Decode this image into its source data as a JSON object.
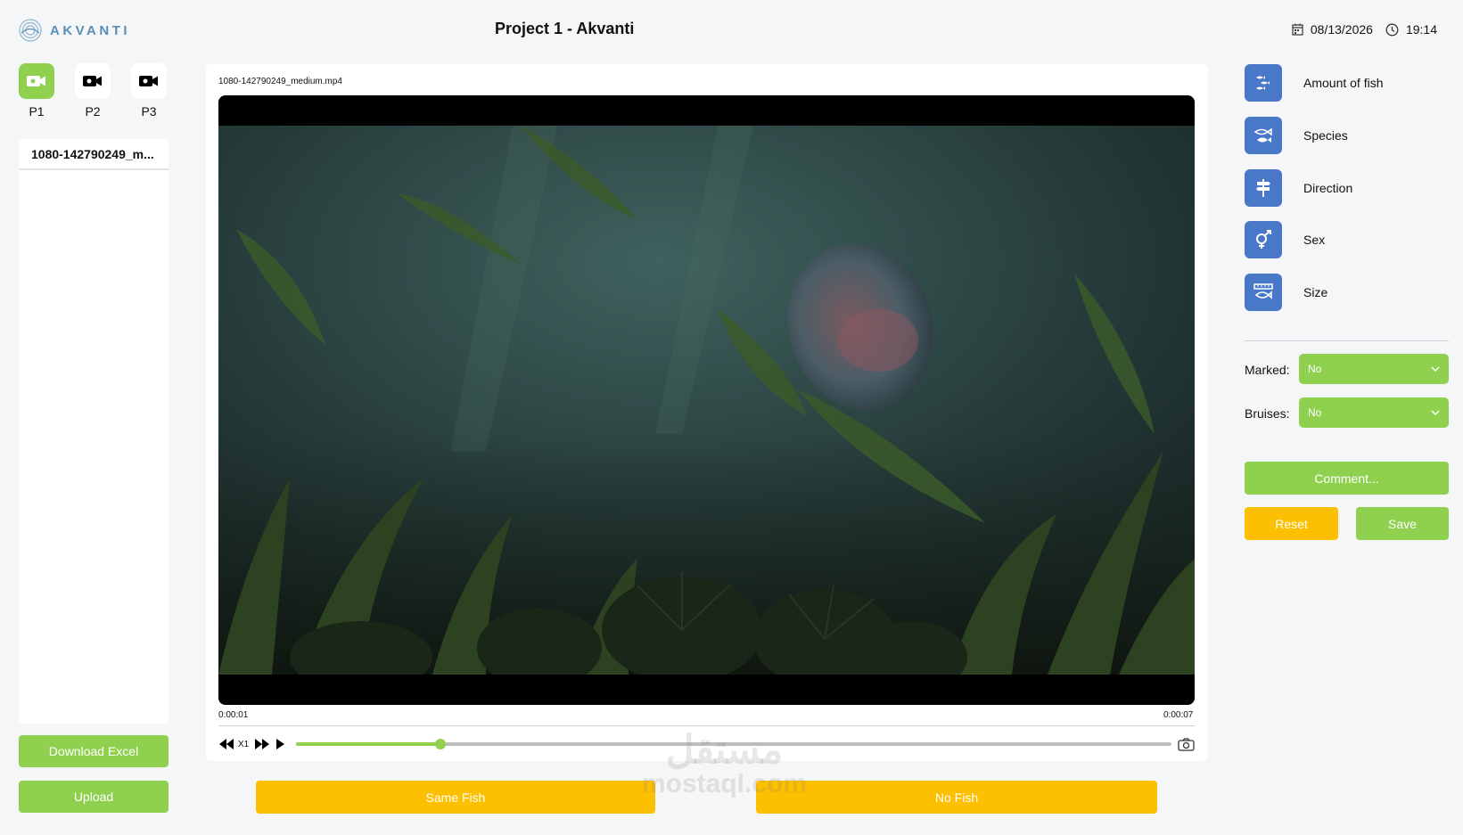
{
  "header": {
    "brand": "AKVANTI",
    "title": "Project 1 - Akvanti",
    "date": "08/13/2026",
    "time": "19:14"
  },
  "cameras": [
    {
      "label": "P1",
      "active": true
    },
    {
      "label": "P2",
      "active": false
    },
    {
      "label": "P3",
      "active": false
    }
  ],
  "files": [
    "1080-142790249_m..."
  ],
  "left_actions": {
    "download": "Download Excel",
    "upload": "Upload"
  },
  "player": {
    "file_name": "1080-142790249_medium.mp4",
    "current_time": "0:00:01",
    "duration": "0:00:07",
    "speed": "X1",
    "progress": 0.165
  },
  "bottom_actions": {
    "same_fish": "Same Fish",
    "no_fish": "No Fish"
  },
  "features": [
    {
      "icon": "fish-count-icon",
      "label": "Amount of fish"
    },
    {
      "icon": "fish-species-icon",
      "label": "Species"
    },
    {
      "icon": "signpost-icon",
      "label": "Direction"
    },
    {
      "icon": "gender-icon",
      "label": "Sex"
    },
    {
      "icon": "ruler-fish-icon",
      "label": "Size"
    }
  ],
  "form": {
    "marked_label": "Marked:",
    "marked_value": "No",
    "bruises_label": "Bruises:",
    "bruises_value": "No",
    "comment": "Comment...",
    "reset": "Reset",
    "save": "Save"
  },
  "watermark": {
    "arabic": "مستقل",
    "latin": "mostaql.com"
  },
  "colors": {
    "accent": "#8fd14f",
    "warning": "#fcc000",
    "icon_bg": "#4a78c8",
    "brand": "#5b8fb3"
  }
}
